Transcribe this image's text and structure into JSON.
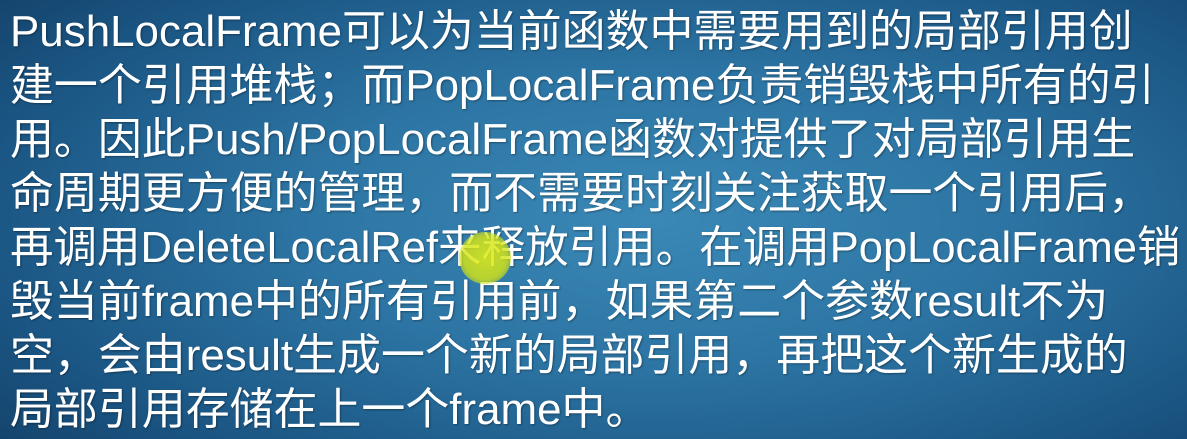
{
  "slide": {
    "lines": [
      "PushLocalFrame可以为当前函数中需要用到的局部引用创",
      "建一个引用堆栈；而PopLocalFrame负责销毁栈中所有的引",
      "用。因此Push/PopLocalFrame函数对提供了对局部引用生",
      "命周期更方便的管理，而不需要时刻关注获取一个引用后，",
      "再调用DeleteLocalRef来释放引用。在调用PopLocalFrame销",
      "毁当前frame中的所有引用前，如果第二个参数result不为",
      "空，会由result生成一个新的局部引用，再把这个新生成的",
      "局部引用存储在上一个frame中。"
    ]
  },
  "colors": {
    "background_center": "#3a88b6",
    "background_edge": "#123f66",
    "text": "#ffffff",
    "cursor_highlight": "#dcec18"
  }
}
